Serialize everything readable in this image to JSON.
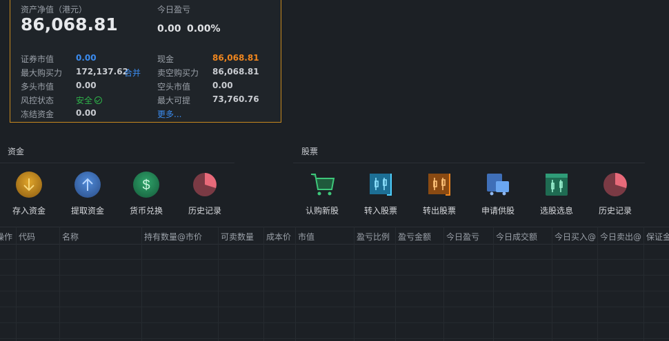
{
  "summary": {
    "net_assets_label": "资产净值（港元）",
    "net_assets_value": "86,068.81",
    "today_pl_label": "今日盈亏",
    "today_pl_value": "0.00",
    "today_pl_pct": "0.00%",
    "rows": [
      {
        "left_label": "证券市值",
        "left_value": "0.00",
        "right_label": "现金",
        "right_value": "86,068.81"
      },
      {
        "left_label": "最大购买力",
        "left_value": "172,137.62",
        "right_label": "卖空购买力",
        "right_value": "86,068.81"
      },
      {
        "left_label": "多头市值",
        "left_value": "0.00",
        "right_label": "空头市值",
        "right_value": "0.00"
      },
      {
        "left_label": "风控状态",
        "left_value": "安全",
        "right_label": "最大可提",
        "right_value": "73,760.76"
      },
      {
        "left_label": "冻结资金",
        "left_value": "0.00",
        "right_label": "",
        "right_value": ""
      }
    ],
    "merge_link": "合并",
    "more_link": "更多..."
  },
  "funds": {
    "title": "资金",
    "tools": [
      {
        "label": "存入资金",
        "icon": "deposit-icon"
      },
      {
        "label": "提取资金",
        "icon": "withdraw-icon"
      },
      {
        "label": "货币兑换",
        "icon": "currency-exchange-icon"
      },
      {
        "label": "历史记录",
        "icon": "history-pie-icon"
      }
    ]
  },
  "stocks": {
    "title": "股票",
    "tools": [
      {
        "label": "认购新股",
        "icon": "ipo-cart-icon"
      },
      {
        "label": "转入股票",
        "icon": "transfer-in-icon"
      },
      {
        "label": "转出股票",
        "icon": "transfer-out-icon"
      },
      {
        "label": "申请供股",
        "icon": "rights-issue-icon"
      },
      {
        "label": "选股选息",
        "icon": "dividend-choice-icon"
      },
      {
        "label": "历史记录",
        "icon": "history-pie-icon"
      }
    ]
  },
  "table": {
    "columns": [
      "操作",
      "代码",
      "名称",
      "持有数量@市价",
      "可卖数量",
      "成本价",
      "市值",
      "盈亏比例",
      "盈亏金额",
      "今日盈亏",
      "今日成交额",
      "今日买入@",
      "今日卖出@",
      "保证金"
    ]
  },
  "colors": {
    "accent_blue": "#3b8cf0",
    "cash_orange": "#f0861e",
    "safe_green": "#2fb34a",
    "panel_border": "#c98a1e"
  }
}
